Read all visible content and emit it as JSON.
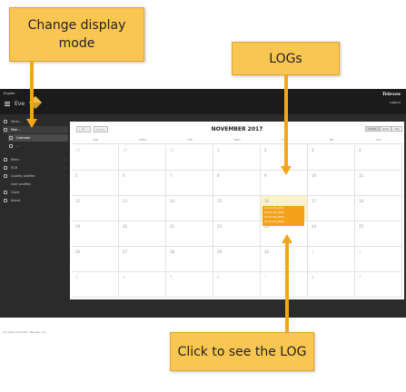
{
  "topbar": {
    "language": "English",
    "title": "Eve",
    "brand": "Televes",
    "logout": "Logout"
  },
  "sidebar": {
    "items": [
      {
        "label": "Versi..."
      },
      {
        "label": "Mon..."
      },
      {
        "label": "Calendar"
      },
      {
        "label": "..."
      },
      {
        "label": "Menu"
      },
      {
        "label": "SCB"
      },
      {
        "label": "Quality profiles"
      },
      {
        "label": "User profiles"
      },
      {
        "label": "Clock"
      },
      {
        "label": "About"
      }
    ],
    "footer": "All rights reserved. Televés, S.A."
  },
  "calendar": {
    "title": "NOVEMBER 2017",
    "nav": {
      "prev": "‹",
      "next": "›",
      "today": "today"
    },
    "views": [
      "month",
      "week",
      "day"
    ],
    "weekdays": [
      "SUN",
      "MON",
      "TUE",
      "WED",
      "THU",
      "FRI",
      "SAT"
    ],
    "weeks": [
      [
        "29",
        "30",
        "31",
        "1",
        "2",
        "3",
        "4"
      ],
      [
        "5",
        "6",
        "7",
        "8",
        "9",
        "10",
        "11"
      ],
      [
        "12",
        "13",
        "14",
        "15",
        "16",
        "17",
        "18"
      ],
      [
        "19",
        "20",
        "21",
        "22",
        "23",
        "24",
        "25"
      ],
      [
        "26",
        "27",
        "28",
        "29",
        "30",
        "1",
        "2"
      ],
      [
        "3",
        "4",
        "5",
        "6",
        "7",
        "8",
        "9"
      ]
    ],
    "events": [
      "10:00 LOG_0001",
      "10:00 LOG_0002",
      "10:00 LOG_0003",
      "10:00 LOG_0004"
    ]
  },
  "callouts": {
    "mode": "Change display mode",
    "logs": "LOGs",
    "click": "Click to see the LOG"
  },
  "colors": {
    "callout": "#f9c652",
    "arrow": "#f4a51a",
    "event": "#f5a21a",
    "app_bg": "#2b2b2b"
  }
}
